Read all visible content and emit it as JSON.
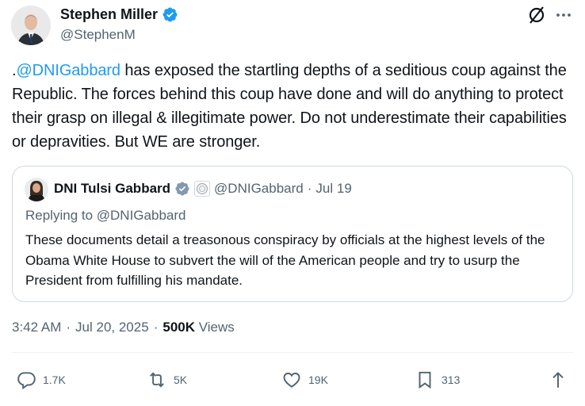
{
  "author": {
    "name": "Stephen Miller",
    "handle": "@StephenM"
  },
  "tweet": {
    "prefix": ".",
    "mention": "@DNIGabbard",
    "body": " has exposed the startling depths of a seditious coup against the Republic. The forces behind this coup have done and will do anything to protect their grasp on illegal & illegitimate power. Do not underestimate their capabilities or depravities. But WE are stronger."
  },
  "quote": {
    "name": "DNI Tulsi Gabbard",
    "handle": "@DNIGabbard",
    "separator": "·",
    "date": "Jul 19",
    "replying_to": "Replying to @DNIGabbard",
    "text": "These documents detail a treasonous conspiracy by officials at the highest levels of the Obama White House to subvert the will of the American people and try to usurp the President from fulfilling his mandate."
  },
  "meta": {
    "time": "3:42 AM",
    "separator": "·",
    "date": "Jul 20, 2025",
    "views_count": "500K",
    "views_label": "Views"
  },
  "actions": {
    "replies": "1.7K",
    "reposts": "5K",
    "likes": "19K",
    "bookmarks": "313"
  },
  "colors": {
    "accent": "#1d9bf0",
    "text": "#0f1419",
    "muted": "#536471",
    "border": "#cfd9de"
  }
}
